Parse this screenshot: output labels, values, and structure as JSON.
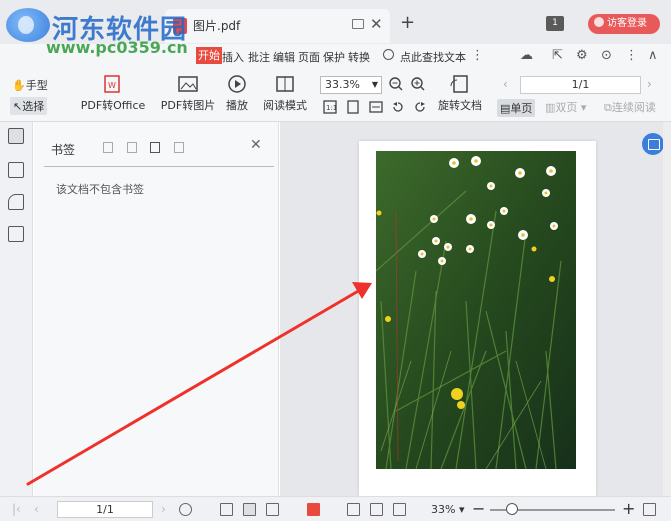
{
  "watermark": {
    "site_name": "河东软件园",
    "url": "www.pc0359.cn"
  },
  "tab": {
    "title": "图片.pdf",
    "close": "✕"
  },
  "tabbar": {
    "new_tab": "+",
    "tab_count": "1",
    "login_label": "访客登录"
  },
  "menu": {
    "items": [
      "开始",
      "插入",
      "批注",
      "编辑",
      "页面",
      "保护",
      "转换"
    ],
    "active": "开始",
    "search_placeholder": "点此查找文本"
  },
  "toolbar": {
    "hand_label": "手型",
    "select_label": "选择",
    "pdf_to_office_label": "PDF转Office",
    "pdf_to_image_label": "PDF转图片",
    "play_label": "播放",
    "read_mode_label": "阅读模式",
    "zoom_value": "33.3%",
    "rotate_label": "旋转文档",
    "page_value": "1/1",
    "single_page_label": "单页",
    "double_page_label": "双页",
    "continuous_label": "连续阅读"
  },
  "bookmarks": {
    "title": "书签",
    "empty_message": "该文档不包含书签",
    "close": "✕"
  },
  "statusbar": {
    "page_value": "1/1",
    "zoom_value": "33%",
    "zoom_out": "−",
    "zoom_in": "+"
  },
  "colors": {
    "accent_red": "#e84a3f",
    "annotation_arrow": "#f0302a",
    "watermark_blue": "#2268c8",
    "watermark_green": "#2d9a3a"
  }
}
